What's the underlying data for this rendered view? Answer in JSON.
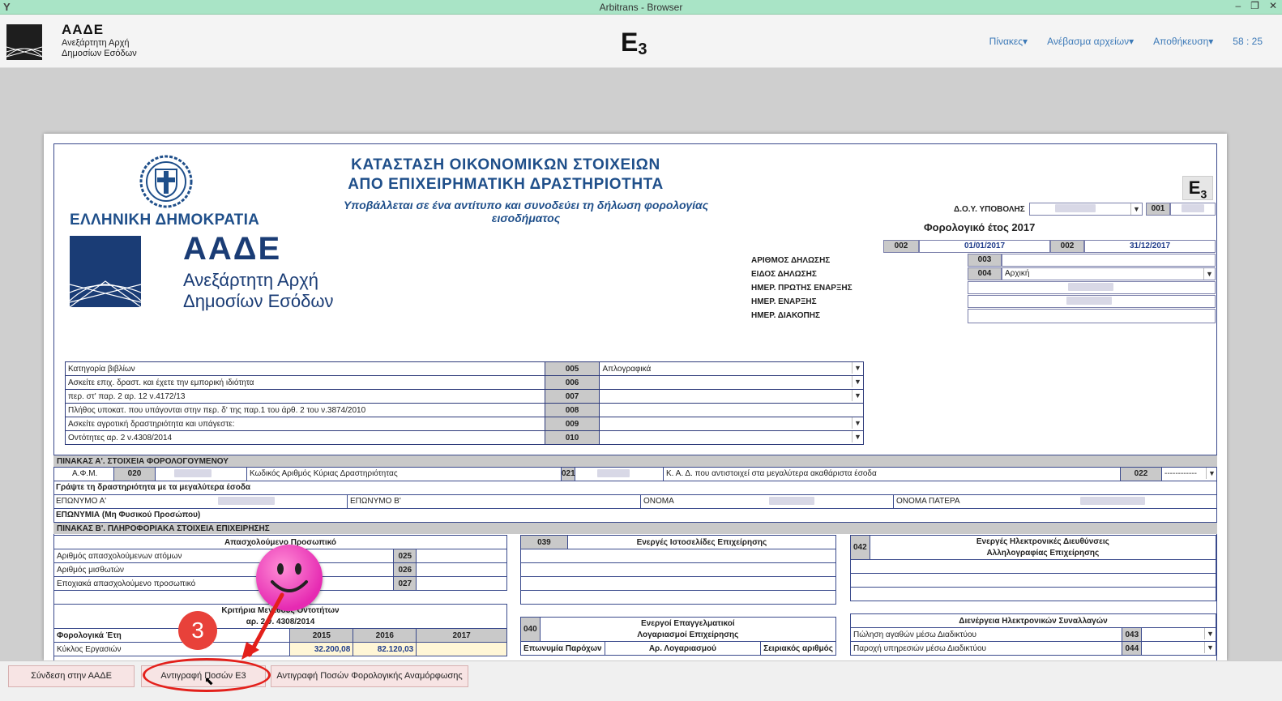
{
  "window": {
    "title": "Arbitrans - Browser",
    "app_icon": "Y",
    "controls": [
      "–",
      "❐",
      "✕"
    ]
  },
  "header": {
    "brand_title": "ΑΑΔΕ",
    "brand_line1": "Ανεξάρτητη Αρχή",
    "brand_line2": "Δημοσίων Εσόδων",
    "page_code": "E",
    "page_code_sub": "3",
    "nav": [
      "Πίνακες▾",
      "Ανέβασμα αρχείων▾",
      "Αποθήκευση▾"
    ],
    "timer": "58 : 25"
  },
  "form": {
    "country": "ΕΛΛΗΝΙΚΗ ΔΗΜΟΚΡΑΤΙΑ",
    "logo_title": "ΑΑΔΕ",
    "logo_sub1": "Ανεξάρτητη Αρχή",
    "logo_sub2": "Δημοσίων Εσόδων",
    "title1": "ΚΑΤΑΣΤΑΣΗ ΟΙΚΟΝΟΜΙΚΩΝ ΣΤΟΙΧΕΙΩΝ",
    "title2": "ΑΠΟ ΕΠΙΧΕΙΡΗΜΑΤΙΚΗ ΔΡΑΣΤΗΡΙΟΤΗΤΑ",
    "subtitle": "Υποβάλλεται σε ένα αντίτυπο και συνοδεύει τη δήλωση φορολογίας εισοδήματος",
    "badge": "E",
    "badge_sub": "3",
    "doy_label": "Δ.Ο.Υ. ΥΠΟΒΟΛΗΣ",
    "code_001": "001",
    "fiscal_year": "Φορολογικό έτος 2017",
    "code_002": "002",
    "date_from": "01/01/2017",
    "date_to": "31/12/2017",
    "decl_number_label": "ΑΡΙΘΜΟΣ ΔΗΛΩΣΗΣ",
    "decl_type_label": "ΕΙΔΟΣ ΔΗΛΩΣΗΣ",
    "first_start_label": "ΗΜΕΡ. ΠΡΩΤΗΣ ΕΝΑΡΞΗΣ",
    "start_label": "ΗΜΕΡ. ΕΝΑΡΞΗΣ",
    "stop_label": "ΗΜΕΡ. ΔΙΑΚΟΠΗΣ",
    "code_003": "003",
    "code_004": "004",
    "decl_type_value": "Αρχική",
    "book_rows": [
      {
        "label": "Κατηγορία βιβλίων",
        "code": "005",
        "value": "Απλογραφικά"
      },
      {
        "label": "Ασκείτε επιχ. δραστ. και έχετε την εμπορική ιδιότητα",
        "code": "006",
        "value": ""
      },
      {
        "label": "περ. στ' παρ. 2 αρ. 12 ν.4172/13",
        "code": "007",
        "value": ""
      },
      {
        "label": "Πλήθος υποκατ. που υπάγονται στην περ. δ' της παρ.1 του άρθ. 2 του ν.3874/2010",
        "code": "008",
        "value": ""
      },
      {
        "label": "Ασκείτε αγροτική δραστηριότητα και υπάγεστε:",
        "code": "009",
        "value": ""
      },
      {
        "label": "Οντότητες αρ. 2 ν.4308/2014",
        "code": "010",
        "value": ""
      }
    ],
    "section_a": "ΠΙΝΑΚΑΣ Α'. ΣΤΟΙΧΕΙΑ ΦΟΡΟΛΟΓΟΥΜΕΝΟΥ",
    "afm_label": "Α.Φ.Μ.",
    "code_020": "020",
    "main_activity_label": "Κωδικός Αριθμός Κύριας Δραστηριότητας",
    "code_021": "021",
    "kad_label": "Κ. Α. Δ. που αντιστοιχεί στα μεγαλύτερα ακαθάριστα έσοδα",
    "code_022": "022",
    "code_022_value": "------------",
    "activity_note": "Γράψτε τη δραστηριότητα με τα μεγαλύτερα έσοδα",
    "surname_a": "ΕΠΩΝΥΜΟ Α'",
    "surname_b": "ΕΠΩΝΥΜΟ Β'",
    "name": "ΟΝΟΜΑ",
    "father_name": "ΟΝΟΜΑ ΠΑΤΕΡΑ",
    "company_name": "ΕΠΩΝΥΜΙΑ (Μη Φυσικού Προσώπου)",
    "section_b": "ΠΙΝΑΚΑΣ Β'. ΠΛΗΡΟΦΟΡΙΑΚΑ ΣΤΟΙΧΕΙΑ ΕΠΙΧΕΙΡΗΣΗΣ",
    "staff_title": "Απασχολούμενο Προσωπικό",
    "staff_rows": [
      {
        "label": "Αριθμός απασχολούμενων ατόμων",
        "code": "025"
      },
      {
        "label": "Αριθμός μισθωτών",
        "code": "026"
      },
      {
        "label": "Εποχιακά απασχολούμενο προσωπικό",
        "code": "027"
      }
    ],
    "websites_code": "039",
    "websites_title": "Ενεργές Ιστοσελίδες Επιχείρησης",
    "emails_code": "042",
    "emails_title1": "Ενεργές Ηλεκτρονικές Διευθύνσεις",
    "emails_title2": "Αλληλογραφίας Επιχείρησης",
    "criteria_title1": "Κριτήρια Μεγέθους Οντοτήτων",
    "criteria_title2": "αρ. 2 ν. 4308/2014",
    "fiscal_years_label": "Φορολογικά Έτη",
    "years": [
      "2015",
      "2016",
      "2017"
    ],
    "turnover_label": "Κύκλος Εργασιών",
    "turnover_values": [
      "32.200,08",
      "82.120,03",
      ""
    ],
    "accounts_code": "040",
    "accounts_title1": "Ενεργοί Επαγγελματικοί",
    "accounts_title2": "Λογαριασμοί Επιχείρησης",
    "provider_label": "Επωνυμία Παρόχων",
    "account_no_label": "Αρ. Λογαριασμού",
    "serial_label": "Σειριακός αριθμός",
    "etrans_title": "Διενέργεια Ηλεκτρονικών Συναλλαγών",
    "etrans_rows": [
      {
        "label": "Πώληση αγαθών μέσω Διαδικτύου",
        "code": "043"
      },
      {
        "label": "Παροχή υπηρεσιών μέσω Διαδικτύου",
        "code": "044"
      }
    ]
  },
  "bottom_buttons": {
    "connect": "Σύνδεση στην ΑΑΔΕ",
    "copy_e3": "Αντιγραφή Ποσών Ε3",
    "copy_reform": "Αντιγραφή Ποσών Φορολογικής Αναμόρφωσης"
  },
  "annotation": {
    "step_number": "3"
  },
  "colors": {
    "brand_blue": "#1f4f8a",
    "titlebar": "#a9e4c6",
    "button_bg": "#f7e4e4",
    "highlight": "#e3201b",
    "smiley": "#e62ab2"
  }
}
